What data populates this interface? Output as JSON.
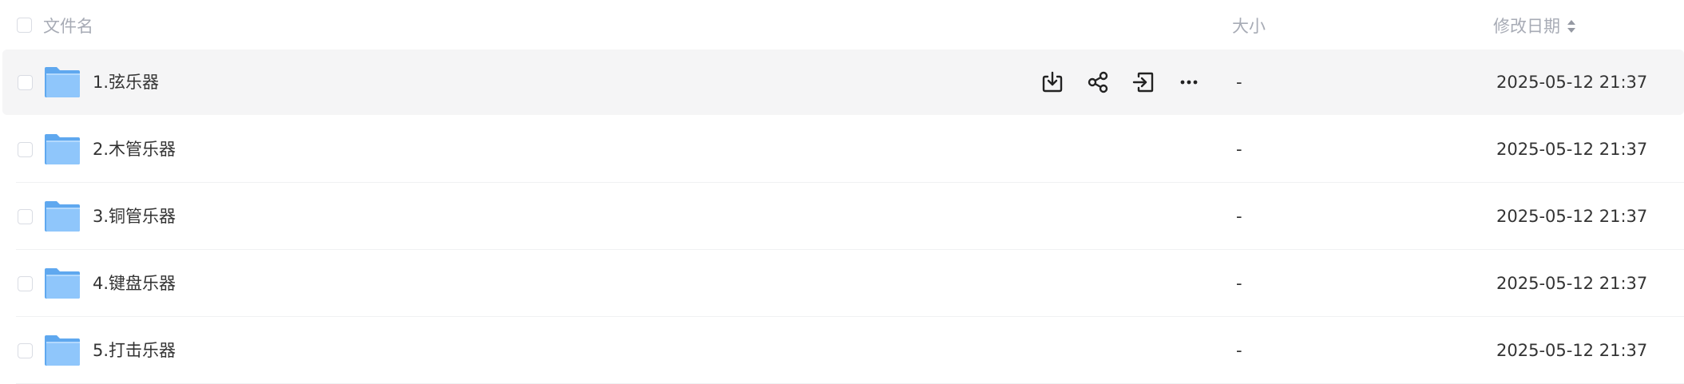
{
  "header": {
    "name_label": "文件名",
    "size_label": "大小",
    "date_label": "修改日期"
  },
  "row_actions": {
    "download_icon": "download-icon",
    "share_icon": "share-icon",
    "move_icon": "move-to-icon",
    "more_icon": "more-icon"
  },
  "files": [
    {
      "name": "1.弦乐器",
      "size": "-",
      "modified": "2025-05-12 21:37",
      "type_icon": "folder-icon"
    },
    {
      "name": "2.木管乐器",
      "size": "-",
      "modified": "2025-05-12 21:37",
      "type_icon": "folder-icon"
    },
    {
      "name": "3.铜管乐器",
      "size": "-",
      "modified": "2025-05-12 21:37",
      "type_icon": "folder-icon"
    },
    {
      "name": "4.键盘乐器",
      "size": "-",
      "modified": "2025-05-12 21:37",
      "type_icon": "folder-icon"
    },
    {
      "name": "5.打击乐器",
      "size": "-",
      "modified": "2025-05-12 21:37",
      "type_icon": "folder-icon"
    }
  ],
  "colors": {
    "header_text": "#a7abb5",
    "row_text": "#333333",
    "hover_bg": "#f5f5f6",
    "folder_back": "#5fa8ef",
    "folder_front": "#8fc6fb"
  }
}
